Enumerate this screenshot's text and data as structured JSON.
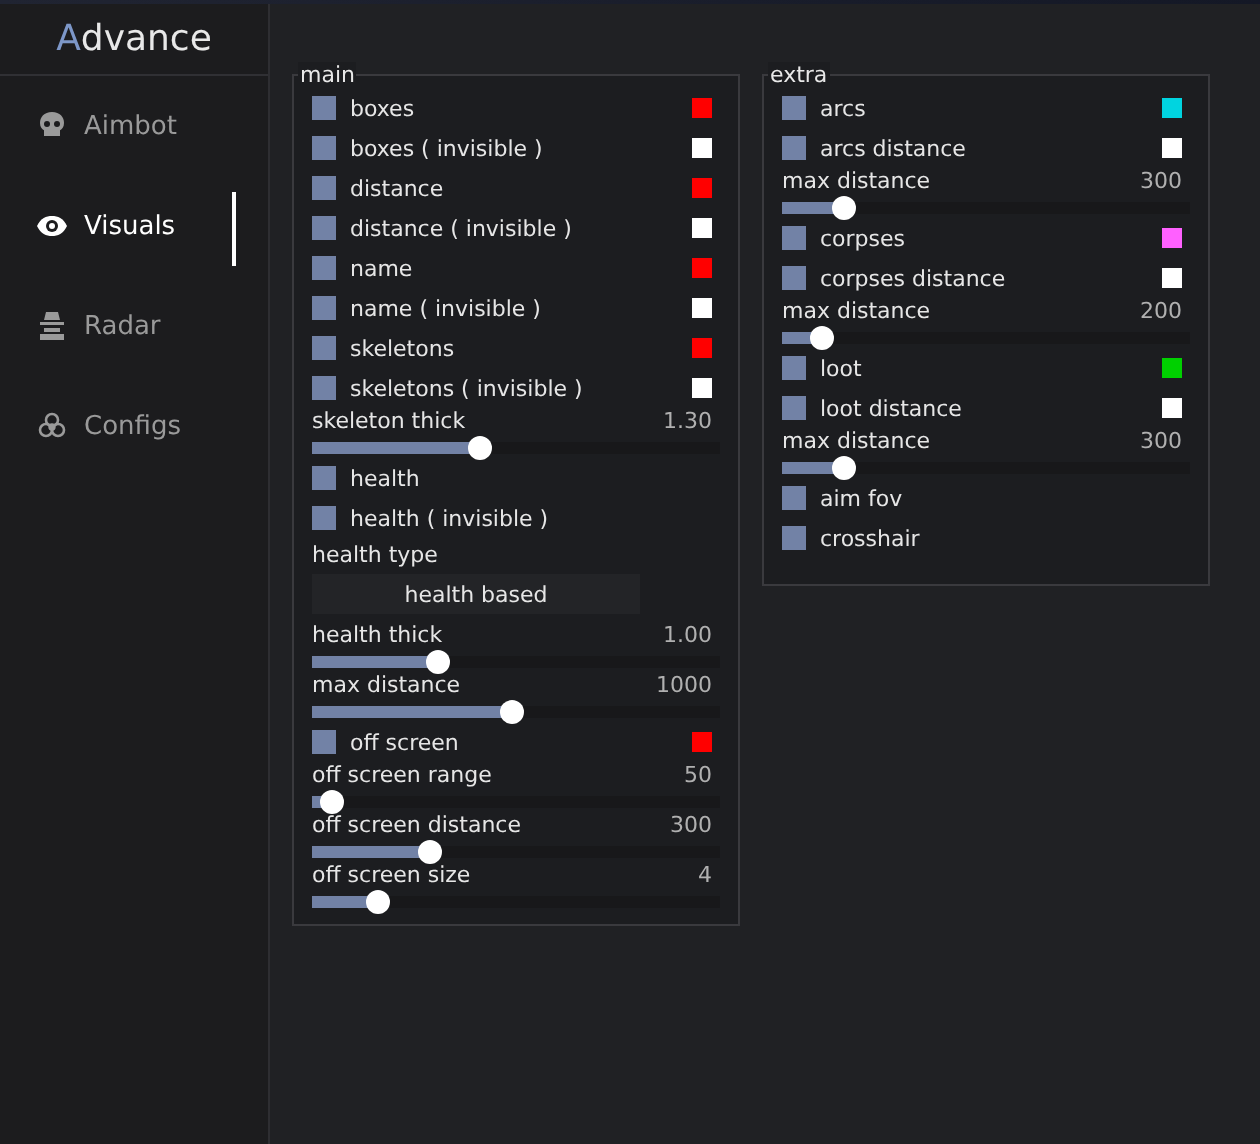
{
  "logo": {
    "accent": "A",
    "rest": "dvance"
  },
  "sidebar": {
    "items": [
      {
        "label": "Aimbot",
        "selected": false
      },
      {
        "label": "Visuals",
        "selected": true
      },
      {
        "label": "Radar",
        "selected": false
      },
      {
        "label": "Configs",
        "selected": false
      }
    ]
  },
  "groups": [
    {
      "title": "main",
      "items": [
        {
          "kind": "checkbox",
          "label": "boxes",
          "checked": false,
          "color": "#ff0000"
        },
        {
          "kind": "checkbox",
          "label": "boxes ( invisible )",
          "checked": false,
          "color": "#ffffff"
        },
        {
          "kind": "checkbox",
          "label": "distance",
          "checked": false,
          "color": "#ff0000"
        },
        {
          "kind": "checkbox",
          "label": "distance ( invisible )",
          "checked": false,
          "color": "#ffffff"
        },
        {
          "kind": "checkbox",
          "label": "name",
          "checked": false,
          "color": "#ff0000"
        },
        {
          "kind": "checkbox",
          "label": "name ( invisible )",
          "checked": false,
          "color": "#ffffff"
        },
        {
          "kind": "checkbox",
          "label": "skeletons",
          "checked": false,
          "color": "#ff0000"
        },
        {
          "kind": "checkbox",
          "label": "skeletons ( invisible )",
          "checked": false,
          "color": "#ffffff"
        },
        {
          "kind": "slider",
          "label": "skeleton thick",
          "reading": "1.30",
          "level": 0.41
        },
        {
          "kind": "checkbox",
          "label": "health",
          "checked": false
        },
        {
          "kind": "checkbox",
          "label": "health ( invisible )",
          "checked": false
        },
        {
          "kind": "combo",
          "label": "health type",
          "value": "health based"
        },
        {
          "kind": "slider",
          "label": "health thick",
          "reading": "1.00",
          "level": 0.31
        },
        {
          "kind": "slider",
          "label": "max distance",
          "reading": "1000",
          "level": 0.49
        },
        {
          "kind": "checkbox",
          "label": "off screen",
          "checked": false,
          "color": "#ff0000"
        },
        {
          "kind": "slider",
          "label": "off screen range",
          "reading": "50",
          "level": 0.05
        },
        {
          "kind": "slider",
          "label": "off screen distance",
          "reading": "300",
          "level": 0.29
        },
        {
          "kind": "slider",
          "label": "off screen size",
          "reading": "4",
          "level": 0.16
        }
      ]
    },
    {
      "title": "extra",
      "items": [
        {
          "kind": "checkbox",
          "label": "arcs",
          "checked": false,
          "color": "#00d4e0"
        },
        {
          "kind": "checkbox",
          "label": "arcs distance",
          "checked": false,
          "color": "#ffffff"
        },
        {
          "kind": "slider",
          "label": "max distance",
          "reading": "300",
          "level": 0.15
        },
        {
          "kind": "checkbox",
          "label": "corpses",
          "checked": false,
          "color": "#ff60ff"
        },
        {
          "kind": "checkbox",
          "label": "corpses distance",
          "checked": false,
          "color": "#ffffff"
        },
        {
          "kind": "slider",
          "label": "max distance",
          "reading": "200",
          "level": 0.1
        },
        {
          "kind": "checkbox",
          "label": "loot",
          "checked": false,
          "color": "#00d000"
        },
        {
          "kind": "checkbox",
          "label": "loot distance",
          "checked": false,
          "color": "#ffffff"
        },
        {
          "kind": "slider",
          "label": "max distance",
          "reading": "300",
          "level": 0.15
        },
        {
          "kind": "checkbox",
          "label": "aim fov",
          "checked": false
        },
        {
          "kind": "checkbox",
          "label": "crosshair",
          "checked": false
        }
      ]
    }
  ]
}
